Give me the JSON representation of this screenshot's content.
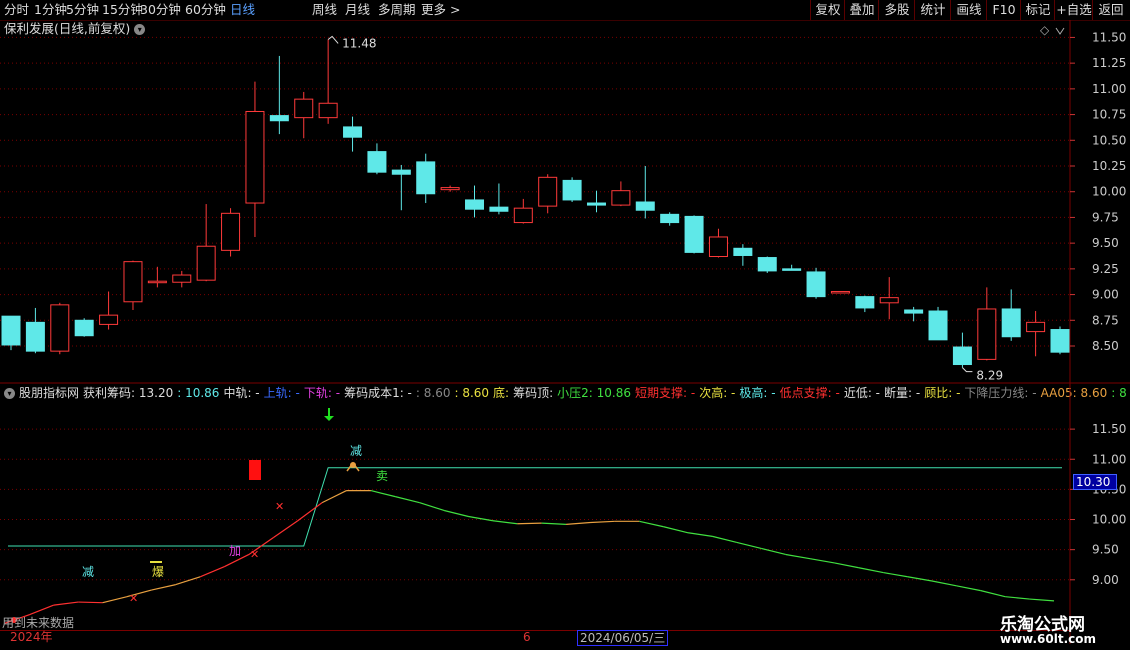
{
  "toolbar": {
    "periods": [
      "分时",
      "1分钟",
      "5分钟",
      "15分钟",
      "30分钟",
      "60分钟",
      "日线",
      "周线",
      "月线",
      "多周期",
      "更多 >"
    ],
    "active_index": 6,
    "right_buttons": [
      "复权",
      "叠加",
      "多股",
      "统计",
      "画线",
      "F10",
      "标记",
      "+自选",
      "返回"
    ]
  },
  "main": {
    "title": "保利发展(日线,前复权)",
    "diamond": "◇",
    "y_ticks": [
      "11.50",
      "11.25",
      "11.00",
      "10.75",
      "10.50",
      "10.25",
      "10.00",
      "9.75",
      "9.50",
      "9.25",
      "9.00",
      "8.75",
      "8.50"
    ],
    "y_values": [
      11.5,
      11.25,
      11.0,
      10.75,
      10.5,
      10.25,
      10.0,
      9.75,
      9.5,
      9.25,
      9.0,
      8.75,
      8.5
    ],
    "high_label": "11.48",
    "low_label": "8.29"
  },
  "indicator": {
    "items": [
      {
        "t": "股朋指标网",
        "c": "#ddd"
      },
      {
        "t": "获利筹码: 13.20",
        "c": "#ddd"
      },
      {
        "t": ": 10.86",
        "c": "#5fe8e8"
      },
      {
        "t": "中轨: -",
        "c": "#ddd"
      },
      {
        "t": "上轨: -",
        "c": "#3a6aff"
      },
      {
        "t": "下轨: -",
        "c": "#e040e0"
      },
      {
        "t": "筹码成本1: -",
        "c": "#ddd"
      },
      {
        "t": ": 8.60",
        "c": "#888"
      },
      {
        "t": ": 8.60",
        "c": "#e8e040"
      },
      {
        "t": "底:",
        "c": "#e8e040"
      },
      {
        "t": "筹码顶:",
        "c": "#ddd"
      },
      {
        "t": "小压2: 10.86",
        "c": "#40e040"
      },
      {
        "t": "短期支撑: -",
        "c": "#ff3030"
      },
      {
        "t": "次高: -",
        "c": "#e8e040"
      },
      {
        "t": "极高: -",
        "c": "#5fe8e8"
      },
      {
        "t": "低点支撑: -",
        "c": "#ff3030"
      },
      {
        "t": "近低: -",
        "c": "#ddd"
      },
      {
        "t": "断量: -",
        "c": "#ddd"
      },
      {
        "t": "顾比: -",
        "c": "#e8e040"
      },
      {
        "t": "下降压力线: -",
        "c": "#888"
      },
      {
        "t": "AA05: 8.60",
        "c": "#e8a040"
      },
      {
        "t": ": 8",
        "c": "#40e040"
      }
    ],
    "y_ticks": [
      "11.50",
      "11.00",
      "10.50",
      "10.00",
      "9.50",
      "9.00"
    ],
    "y_values": [
      11.5,
      11.0,
      10.5,
      10.0,
      9.5,
      9.0
    ],
    "current_value": "10.30",
    "labels": {
      "jian1": "减",
      "bao": "爆",
      "jia": "加",
      "jian2": "减",
      "mai": "卖"
    }
  },
  "footer": {
    "note": "用到未来数据",
    "year": "2024年",
    "month": "6",
    "date": "2024/06/05/三",
    "watermark_cn": "乐淘公式网",
    "watermark_url": "www.60lt.com"
  },
  "colors": {
    "up": "#ff3a3a",
    "down": "#5fe8e8",
    "grid": "#7a0000"
  },
  "chart_data": {
    "type": "candlestick",
    "ohlc": [
      [
        8.79,
        8.79,
        8.51,
        8.46
      ],
      [
        8.73,
        8.87,
        8.45,
        8.43
      ],
      [
        8.45,
        8.92,
        8.9,
        8.42
      ],
      [
        8.75,
        8.77,
        8.6,
        8.59
      ],
      [
        8.71,
        9.03,
        8.8,
        8.66
      ],
      [
        8.93,
        9.33,
        9.32,
        8.85
      ],
      [
        9.12,
        9.27,
        9.13,
        9.07
      ],
      [
        9.12,
        9.23,
        9.19,
        9.07
      ],
      [
        9.14,
        9.88,
        9.47,
        9.13
      ],
      [
        9.43,
        9.84,
        9.79,
        9.37
      ],
      [
        9.89,
        11.07,
        10.78,
        9.56
      ],
      [
        10.74,
        11.32,
        10.69,
        10.56
      ],
      [
        10.72,
        10.97,
        10.9,
        10.52
      ],
      [
        10.72,
        11.48,
        10.86,
        10.66
      ],
      [
        10.63,
        10.73,
        10.53,
        10.39
      ],
      [
        10.39,
        10.47,
        10.19,
        10.17
      ],
      [
        10.21,
        10.26,
        10.17,
        9.82
      ],
      [
        10.29,
        10.37,
        9.98,
        9.89
      ],
      [
        10.02,
        10.06,
        10.04,
        10.0
      ],
      [
        9.92,
        10.06,
        9.83,
        9.75
      ],
      [
        9.85,
        10.08,
        9.81,
        9.78
      ],
      [
        9.7,
        9.93,
        9.84,
        9.69
      ],
      [
        9.86,
        10.17,
        10.14,
        9.79
      ],
      [
        10.11,
        10.14,
        9.92,
        9.9
      ],
      [
        9.89,
        10.01,
        9.87,
        9.8
      ],
      [
        9.87,
        10.1,
        10.01,
        9.86
      ],
      [
        9.9,
        10.25,
        9.82,
        9.74
      ],
      [
        9.78,
        9.8,
        9.7,
        9.67
      ],
      [
        9.76,
        9.77,
        9.41,
        9.4
      ],
      [
        9.37,
        9.64,
        9.56,
        9.36
      ],
      [
        9.45,
        9.49,
        9.38,
        9.28
      ],
      [
        9.36,
        9.37,
        9.23,
        9.21
      ],
      [
        9.25,
        9.29,
        9.24,
        9.24
      ],
      [
        9.22,
        9.26,
        8.98,
        8.96
      ],
      [
        9.03,
        9.03,
        9.03,
        9.03
      ],
      [
        8.98,
        8.99,
        8.87,
        8.83
      ],
      [
        8.92,
        9.17,
        8.97,
        8.76
      ],
      [
        8.85,
        8.88,
        8.82,
        8.74
      ],
      [
        8.84,
        8.88,
        8.56,
        8.56
      ],
      [
        8.49,
        8.63,
        8.32,
        8.29
      ],
      [
        8.37,
        9.07,
        8.86,
        8.36
      ],
      [
        8.86,
        9.05,
        8.59,
        8.55
      ],
      [
        8.64,
        8.84,
        8.73,
        8.4
      ],
      [
        8.66,
        8.69,
        8.44,
        8.42
      ]
    ],
    "cost_line": [
      8.28,
      8.42,
      8.58,
      8.63,
      8.62,
      8.72,
      8.83,
      8.92,
      9.05,
      9.22,
      9.42,
      9.7,
      9.98,
      10.28,
      10.48,
      10.48,
      10.38,
      10.28,
      10.15,
      10.05,
      9.98,
      9.93,
      9.94,
      9.92,
      9.95,
      9.97,
      9.97,
      9.88,
      9.78,
      9.72,
      9.62,
      9.52,
      9.42,
      9.35,
      9.28,
      9.2,
      9.12,
      9.05,
      8.98,
      8.9,
      8.82,
      8.72,
      8.68,
      8.65
    ],
    "step_line": {
      "low": 9.56,
      "high": 10.86,
      "jump_from": 12,
      "jump_to": 13
    },
    "ylim_main": [
      8.15,
      11.65
    ],
    "ylim_ind": [
      8.2,
      11.95
    ]
  }
}
